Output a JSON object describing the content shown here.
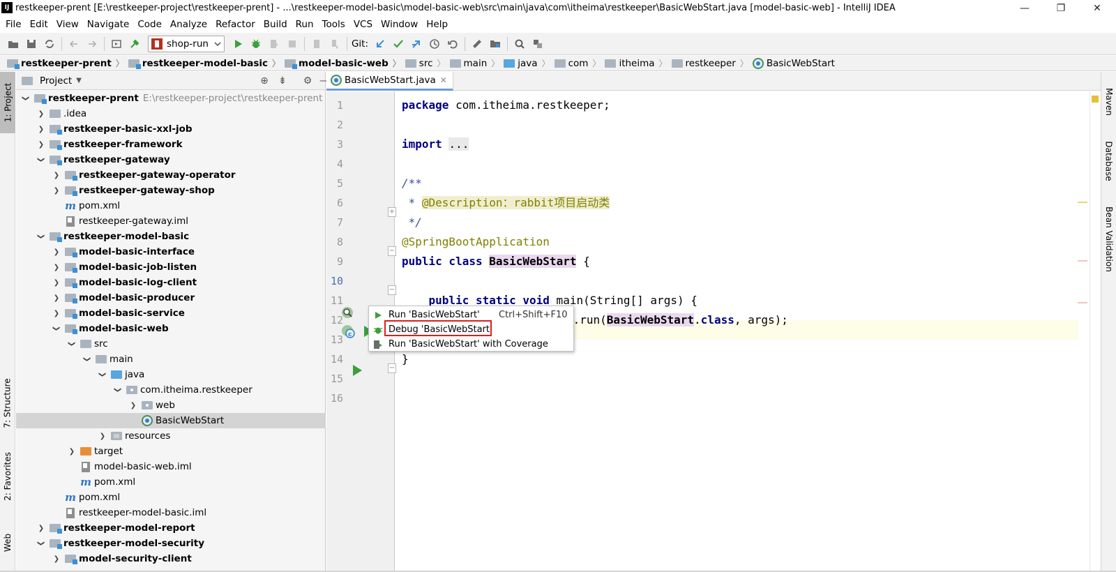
{
  "window": {
    "title": "restkeeper-prent [E:\\restkeeper-project\\restkeeper-prent] - ...\\restkeeper-model-basic\\model-basic-web\\src\\main\\java\\com\\itheima\\restkeeper\\BasicWebStart.java [model-basic-web] - IntelliJ IDEA",
    "app_icon": "IJ",
    "controls": [
      "—",
      "❐",
      "✕"
    ]
  },
  "menu": [
    "File",
    "Edit",
    "View",
    "Navigate",
    "Code",
    "Analyze",
    "Refactor",
    "Build",
    "Run",
    "Tools",
    "VCS",
    "Window",
    "Help"
  ],
  "toolbar": {
    "run_config": "shop-run",
    "git_label": "Git:",
    "icons": [
      "open-folder-icon",
      "save-icon",
      "sync-icon",
      "back-icon",
      "forward-icon",
      "run-config-icon",
      "build-icon",
      "run-icon",
      "debug-icon",
      "coverage-icon",
      "stop-icon",
      "git-update-icon",
      "git-commit-icon",
      "git-push-icon",
      "history-icon",
      "revert-icon",
      "settings-icon",
      "project-structure-icon",
      "search-icon",
      "vcs-icon"
    ]
  },
  "breadcrumbs": [
    {
      "label": "restkeeper-prent",
      "bold": true,
      "icon": "module-folder"
    },
    {
      "label": "restkeeper-model-basic",
      "bold": true,
      "icon": "module-folder"
    },
    {
      "label": "model-basic-web",
      "bold": true,
      "icon": "module-folder"
    },
    {
      "label": "src",
      "bold": false,
      "icon": "folder"
    },
    {
      "label": "main",
      "bold": false,
      "icon": "folder"
    },
    {
      "label": "java",
      "bold": false,
      "icon": "folder-blue"
    },
    {
      "label": "com",
      "bold": false,
      "icon": "folder"
    },
    {
      "label": "itheima",
      "bold": false,
      "icon": "folder"
    },
    {
      "label": "restkeeper",
      "bold": false,
      "icon": "folder"
    },
    {
      "label": "BasicWebStart",
      "bold": false,
      "icon": "spring-class"
    }
  ],
  "left_strip": {
    "project": "1: Project",
    "structure": "7: Structure",
    "favorites": "2: Favorites",
    "web": "Web"
  },
  "right_strip": {
    "maven": "Maven",
    "database": "Database",
    "bean": "Bean Validation"
  },
  "project": {
    "header": "Project",
    "tree": [
      {
        "label": "restkeeper-prent",
        "path": "E:\\restkeeper-project\\restkeeper-prent",
        "depth": 0,
        "arrow": "down",
        "bold": true,
        "icon": "module-folder"
      },
      {
        "label": ".idea",
        "depth": 1,
        "arrow": "right",
        "bold": false,
        "icon": "folder"
      },
      {
        "label": "restkeeper-basic-xxl-job",
        "depth": 1,
        "arrow": "right",
        "bold": true,
        "icon": "module-folder"
      },
      {
        "label": "restkeeper-framework",
        "depth": 1,
        "arrow": "right",
        "bold": true,
        "icon": "module-folder"
      },
      {
        "label": "restkeeper-gateway",
        "depth": 1,
        "arrow": "down",
        "bold": true,
        "icon": "module-folder"
      },
      {
        "label": "restkeeper-gateway-operator",
        "depth": 2,
        "arrow": "right",
        "bold": true,
        "icon": "module-folder"
      },
      {
        "label": "restkeeper-gateway-shop",
        "depth": 2,
        "arrow": "right",
        "bold": true,
        "icon": "module-folder"
      },
      {
        "label": "pom.xml",
        "depth": 2,
        "arrow": "none",
        "bold": false,
        "icon": "maven"
      },
      {
        "label": "restkeeper-gateway.iml",
        "depth": 2,
        "arrow": "none",
        "bold": false,
        "icon": "iml"
      },
      {
        "label": "restkeeper-model-basic",
        "depth": 1,
        "arrow": "down",
        "bold": true,
        "icon": "module-folder"
      },
      {
        "label": "model-basic-interface",
        "depth": 2,
        "arrow": "right",
        "bold": true,
        "icon": "module-folder"
      },
      {
        "label": "model-basic-job-listen",
        "depth": 2,
        "arrow": "right",
        "bold": true,
        "icon": "module-folder"
      },
      {
        "label": "model-basic-log-client",
        "depth": 2,
        "arrow": "right",
        "bold": true,
        "icon": "module-folder"
      },
      {
        "label": "model-basic-producer",
        "depth": 2,
        "arrow": "right",
        "bold": true,
        "icon": "module-folder"
      },
      {
        "label": "model-basic-service",
        "depth": 2,
        "arrow": "right",
        "bold": true,
        "icon": "module-folder"
      },
      {
        "label": "model-basic-web",
        "depth": 2,
        "arrow": "down",
        "bold": true,
        "icon": "module-folder"
      },
      {
        "label": "src",
        "depth": 3,
        "arrow": "down",
        "bold": false,
        "icon": "folder"
      },
      {
        "label": "main",
        "depth": 4,
        "arrow": "down",
        "bold": false,
        "icon": "folder"
      },
      {
        "label": "java",
        "depth": 5,
        "arrow": "down",
        "bold": false,
        "icon": "folder-blue"
      },
      {
        "label": "com.itheima.restkeeper",
        "depth": 6,
        "arrow": "down",
        "bold": false,
        "icon": "package"
      },
      {
        "label": "web",
        "depth": 7,
        "arrow": "right",
        "bold": false,
        "icon": "package"
      },
      {
        "label": "BasicWebStart",
        "depth": 7,
        "arrow": "none",
        "bold": false,
        "icon": "spring-class",
        "selected": true
      },
      {
        "label": "resources",
        "depth": 5,
        "arrow": "right",
        "bold": false,
        "icon": "resources"
      },
      {
        "label": "target",
        "depth": 3,
        "arrow": "right",
        "bold": false,
        "icon": "folder-orange"
      },
      {
        "label": "model-basic-web.iml",
        "depth": 3,
        "arrow": "none",
        "bold": false,
        "icon": "iml"
      },
      {
        "label": "pom.xml",
        "depth": 3,
        "arrow": "none",
        "bold": false,
        "icon": "maven"
      },
      {
        "label": "pom.xml",
        "depth": 2,
        "arrow": "none",
        "bold": false,
        "icon": "maven"
      },
      {
        "label": "restkeeper-model-basic.iml",
        "depth": 2,
        "arrow": "none",
        "bold": false,
        "icon": "iml"
      },
      {
        "label": "restkeeper-model-report",
        "depth": 1,
        "arrow": "right",
        "bold": true,
        "icon": "module-folder"
      },
      {
        "label": "restkeeper-model-security",
        "depth": 1,
        "arrow": "down",
        "bold": true,
        "icon": "module-folder"
      },
      {
        "label": "model-security-client",
        "depth": 2,
        "arrow": "right",
        "bold": true,
        "icon": "module-folder"
      }
    ]
  },
  "editor": {
    "tab": "BasicWebStart.java",
    "line_numbers": [
      "1",
      "2",
      "3",
      "4",
      "5",
      "6",
      "7",
      "8",
      "9",
      "10",
      "11",
      "12",
      "13",
      "14",
      "15",
      "16"
    ],
    "code": {
      "l1_kw": "package",
      "l1_rest": " com.itheima.restkeeper;",
      "l3_kw": "import",
      "l3_fold": "...",
      "l6": "/**",
      "l7_star": " * ",
      "l7_tag": "@Description：rabbit项目启动类",
      "l8": " */",
      "l9": "@SpringBootApplication",
      "l10_kw": "public class",
      "l10_cls": "BasicWebStart",
      "l10_rest": " {",
      "l12_kw": "public static void",
      "l12_method": " main",
      "l12_rest": "(String[] ",
      "l12_param": "args",
      "l12_end": ") {",
      "l13_tail": "a.run(",
      "l13_cls": "BasicWebStart",
      "l13_dot": ".",
      "l13_class": "class",
      "l13_end": ", ",
      "l13_args": "args",
      "l13_close": ");",
      "l15": "}"
    }
  },
  "popup": {
    "run_label": "Run 'BasicWebStart'",
    "run_shortcut": "Ctrl+Shift+F10",
    "debug_label": "Debug 'BasicWebStart'",
    "coverage_label": "Run 'BasicWebStart' with Coverage"
  },
  "colors": {
    "highlight_border": "#e01c1c",
    "run_green": "#3c9f3c",
    "selection": "#d4d4d4"
  }
}
